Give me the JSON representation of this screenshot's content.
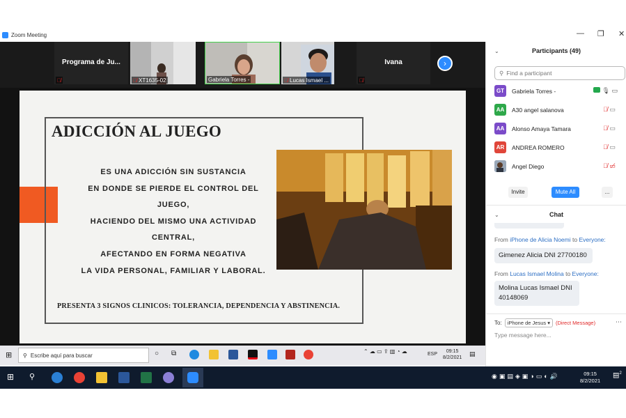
{
  "window": {
    "title": "Zoom Meeting",
    "minimize": "—",
    "maximize": "❐",
    "close": "✕"
  },
  "video_strip": {
    "tiles": [
      {
        "name": "Programa de Ju...",
        "label": ""
      },
      {
        "name": "",
        "label": "XT1635-02"
      },
      {
        "name": "",
        "label": "Gabriela Torres -"
      },
      {
        "name": "",
        "label": "Lucas Ismael ..."
      },
      {
        "name": "Ivana",
        "label": ""
      }
    ],
    "next_icon": "chevron-right"
  },
  "slide": {
    "heading": "ADICCIÓN AL JUEGO",
    "body_lines": [
      "ES UNA ADICCIÓN SIN SUSTANCIA",
      "EN DONDE SE PIERDE EL CONTROL DEL",
      "JUEGO,",
      "HACIENDO DEL MISMO UNA ACTIVIDAD",
      "CENTRAL,",
      "AFECTANDO EN FORMA NEGATIVA",
      "LA VIDA PERSONAL, FAMILIAR Y LABORAL."
    ],
    "footer": "PRESENTA 3 SIGNOS CLINICOS: TOLERANCIA, DEPENDENCIA Y ABSTINENCIA.",
    "accent_color": "#f05a22"
  },
  "inner_taskbar": {
    "search_placeholder": "Escribe aquí para buscar",
    "lang": "ESP",
    "time": "09:15",
    "date": "8/2/2021"
  },
  "participants": {
    "header": "Participants (49)",
    "find_placeholder": "Find a participant",
    "list": [
      {
        "initials": "GT",
        "name": "Gabriela Torres -",
        "color": "#7b4bc9"
      },
      {
        "initials": "AA",
        "name": "A30 angel salanova",
        "color": "#2ea84a"
      },
      {
        "initials": "AA",
        "name": "Alonso Amaya Tamara",
        "color": "#7b4bc9"
      },
      {
        "initials": "AR",
        "name": "ANDREA ROMERO",
        "color": "#e0463a"
      },
      {
        "initials": "",
        "name": "Angel Diego",
        "color": "#555555"
      }
    ],
    "invite": "Invite",
    "mute_all": "Mute All",
    "more": "..."
  },
  "chat": {
    "header": "Chat",
    "messages": [
      {
        "from_prefix": "From",
        "sender": "iPhone de Alicia Noemi",
        "to_word": "to",
        "recipient": "Everyone:",
        "text": "Gimenez Alicia DNI 27700180"
      },
      {
        "from_prefix": "From",
        "sender": "Lucas Ismael Molina",
        "to_word": "to",
        "recipient": "Everyone:",
        "text": "Molina Lucas Ismael DNI 40148069"
      }
    ],
    "to_label": "To:",
    "to_value": "iPhone de Jesus ▾",
    "dm_label": "(Direct Message)",
    "input_placeholder": "Type message here..."
  },
  "host_taskbar": {
    "time": "09:15",
    "date": "8/2/2021",
    "notif_count": "2"
  }
}
